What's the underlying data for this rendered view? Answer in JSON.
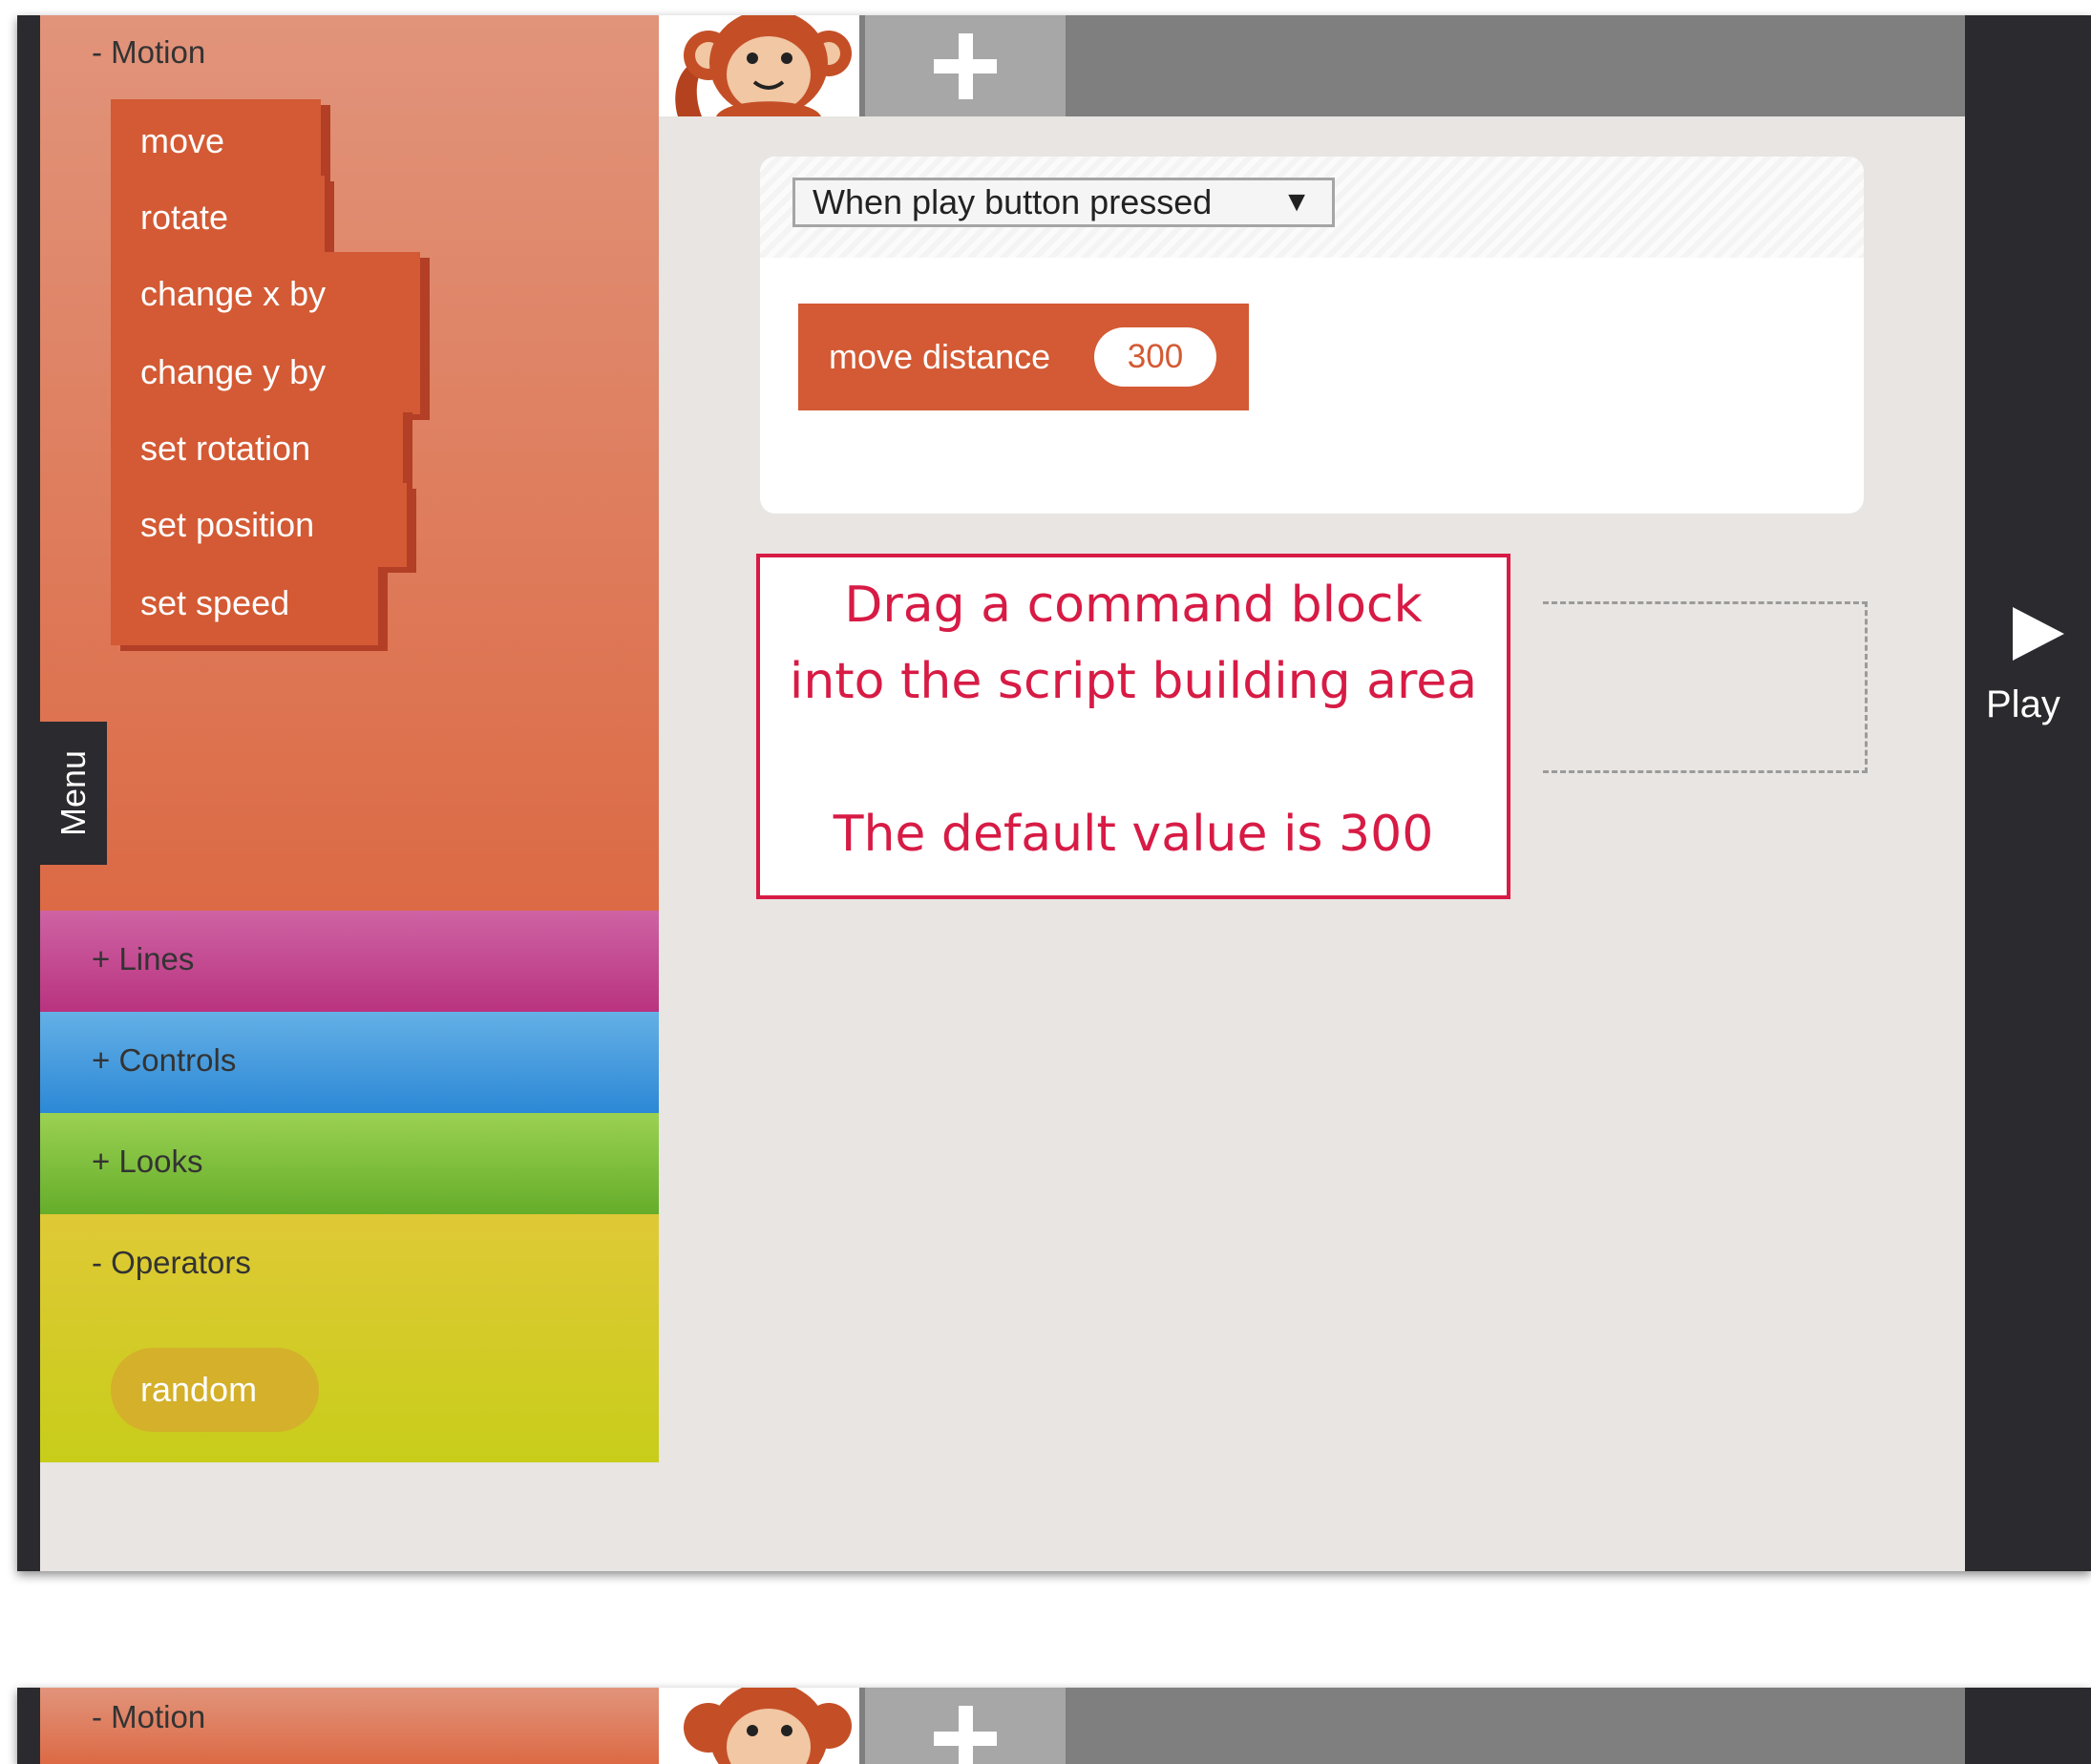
{
  "palette": {
    "motion": {
      "header": "- Motion",
      "blocks": [
        "move",
        "rotate",
        "change x by",
        "change y by",
        "set rotation",
        "set position",
        "set speed"
      ]
    },
    "lines": {
      "header": "+ Lines"
    },
    "controls": {
      "header": "+ Controls"
    },
    "looks": {
      "header": "+ Looks"
    },
    "operators": {
      "header": "- Operators",
      "blocks": [
        "random"
      ]
    },
    "menu_tab": "Menu"
  },
  "tabs": {
    "sprite": "monkey sprite",
    "add_icon": "plus-icon"
  },
  "script": {
    "trigger": "When play button pressed",
    "trigger_arrow": "▼",
    "command": {
      "label": "move distance",
      "value": "300"
    }
  },
  "callout": {
    "line1": "Drag a command block",
    "line2": "into the script building area",
    "line3": "The default value is 300"
  },
  "play": {
    "label": "Play"
  },
  "bottom_frame": {
    "header": "- Motion"
  },
  "colors": {
    "motion": "#dc6a45",
    "lines": "#b9337f",
    "controls": "#2c88d5",
    "looks": "#65ad2a",
    "operators": "#c8cd1a",
    "callout": "#d71b45"
  }
}
